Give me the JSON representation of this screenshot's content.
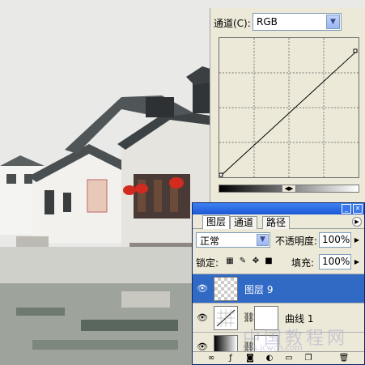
{
  "curves": {
    "channel_label": "通道(C):",
    "channel_value": "RGB"
  },
  "layers": {
    "tabs": [
      "图层",
      "通道",
      "路径"
    ],
    "blend_mode": "正常",
    "opacity_label": "不透明度:",
    "opacity_value": "100%",
    "lock_label": "锁定:",
    "fill_label": "填充:",
    "fill_value": "100%",
    "items": [
      {
        "name": "图层 9",
        "selected": true
      },
      {
        "name": "曲线 1",
        "selected": false
      },
      {
        "name": "",
        "selected": false
      }
    ]
  },
  "colors": {
    "selection": "#316ac5",
    "lantern": "#d22a1e"
  },
  "watermark": {
    "text": "中国教程网",
    "url": "bbs.jcwcn.com"
  }
}
